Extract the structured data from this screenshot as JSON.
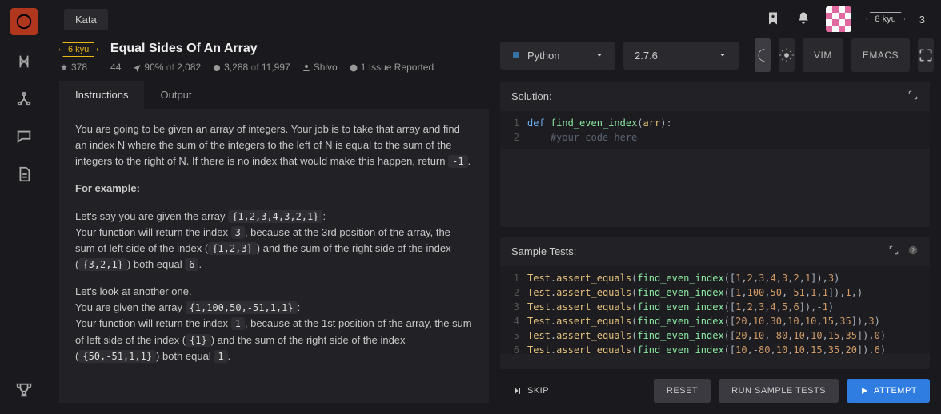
{
  "nav_tab": "Kata",
  "user": {
    "rank_label": "8 kyu",
    "points": "3"
  },
  "kata": {
    "rank": "6 kyu",
    "title": "Equal Sides Of An Array",
    "stars": "378",
    "collections": "44",
    "satisfaction_pct": "90%",
    "satisfaction_of": "of",
    "satisfaction_total": "2,082",
    "completed": "3,288",
    "completed_of": "of",
    "completed_total": "11,997",
    "author": "Shivo",
    "issues": "1 Issue Reported"
  },
  "tabs": {
    "instructions": "Instructions",
    "output": "Output"
  },
  "desc": {
    "p1a": "You are going to be given an array of integers. Your job is to take that array and find an index N where the sum of the integers to the left of N is equal to the sum of the integers to the right of N. If there is no index that would make this happen, return ",
    "p1_code": "-1",
    "p1b": ".",
    "h1": "For example:",
    "p2a": "Let's say you are given the array ",
    "p2_code1": "{1,2,3,4,3,2,1}",
    "p2b": ":",
    "p2c": "Your function will return the index ",
    "p2_code2": "3",
    "p2d": ", because at the 3rd position of the array, the sum of left side of the index (",
    "p2_code3": "{1,2,3}",
    "p2e": ") and the sum of the right side of the index (",
    "p2_code4": "{3,2,1}",
    "p2f": ") both equal ",
    "p2_code5": "6",
    "p2g": ".",
    "p3a": "Let's look at another one.",
    "p3b": "You are given the array ",
    "p3_code1": "{1,100,50,-51,1,1}",
    "p3c": ":",
    "p3d": "Your function will return the index ",
    "p3_code2": "1",
    "p3e": ", because at the 1st position of the array, the sum of left side of the index (",
    "p3_code3": "{1}",
    "p3f": ") and the sum of the right side of the index (",
    "p3_code4": "{50,-51,1,1}",
    "p3g": ") both equal ",
    "p3_code5": "1",
    "p3h": "."
  },
  "editor": {
    "language": "Python",
    "version": "2.7.6",
    "mode_vim": "VIM",
    "mode_emacs": "EMACS"
  },
  "solution": {
    "title": "Solution:",
    "lines": [
      {
        "n": "1",
        "html": "<span class='tk-kw'>def</span> <span class='tk-fn'>find_even_index</span><span class='tk-plain'>(</span><span class='tk-id'>arr</span><span class='tk-plain'>):</span>"
      },
      {
        "n": "2",
        "html": "    <span class='tk-cmt'>#your code here</span>"
      }
    ]
  },
  "tests": {
    "title": "Sample Tests:",
    "lines": [
      {
        "n": "1",
        "html": "<span class='tk-id'>Test</span><span class='tk-plain'>.</span><span class='tk-call'>assert_equals</span><span class='tk-plain'>(</span><span class='tk-fn'>find_even_index</span><span class='tk-plain'>([</span><span class='tk-num'>1</span><span class='tk-plain'>,</span><span class='tk-num'>2</span><span class='tk-plain'>,</span><span class='tk-num'>3</span><span class='tk-plain'>,</span><span class='tk-num'>4</span><span class='tk-plain'>,</span><span class='tk-num'>3</span><span class='tk-plain'>,</span><span class='tk-num'>2</span><span class='tk-plain'>,</span><span class='tk-num'>1</span><span class='tk-plain'>]),</span><span class='tk-num'>3</span><span class='tk-plain'>)</span>"
      },
      {
        "n": "2",
        "html": "<span class='tk-id'>Test</span><span class='tk-plain'>.</span><span class='tk-call'>assert_equals</span><span class='tk-plain'>(</span><span class='tk-fn'>find_even_index</span><span class='tk-plain'>([</span><span class='tk-num'>1</span><span class='tk-plain'>,</span><span class='tk-num'>100</span><span class='tk-plain'>,</span><span class='tk-num'>50</span><span class='tk-plain'>,-</span><span class='tk-num'>51</span><span class='tk-plain'>,</span><span class='tk-num'>1</span><span class='tk-plain'>,</span><span class='tk-num'>1</span><span class='tk-plain'>]),</span><span class='tk-num'>1</span><span class='tk-plain'>,)</span>"
      },
      {
        "n": "3",
        "html": "<span class='tk-id'>Test</span><span class='tk-plain'>.</span><span class='tk-call'>assert_equals</span><span class='tk-plain'>(</span><span class='tk-fn'>find_even_index</span><span class='tk-plain'>([</span><span class='tk-num'>1</span><span class='tk-plain'>,</span><span class='tk-num'>2</span><span class='tk-plain'>,</span><span class='tk-num'>3</span><span class='tk-plain'>,</span><span class='tk-num'>4</span><span class='tk-plain'>,</span><span class='tk-num'>5</span><span class='tk-plain'>,</span><span class='tk-num'>6</span><span class='tk-plain'>]),-</span><span class='tk-num'>1</span><span class='tk-plain'>)</span>"
      },
      {
        "n": "4",
        "html": "<span class='tk-id'>Test</span><span class='tk-plain'>.</span><span class='tk-call'>assert_equals</span><span class='tk-plain'>(</span><span class='tk-fn'>find_even_index</span><span class='tk-plain'>([</span><span class='tk-num'>20</span><span class='tk-plain'>,</span><span class='tk-num'>10</span><span class='tk-plain'>,</span><span class='tk-num'>30</span><span class='tk-plain'>,</span><span class='tk-num'>10</span><span class='tk-plain'>,</span><span class='tk-num'>10</span><span class='tk-plain'>,</span><span class='tk-num'>15</span><span class='tk-plain'>,</span><span class='tk-num'>35</span><span class='tk-plain'>]),</span><span class='tk-num'>3</span><span class='tk-plain'>)</span>"
      },
      {
        "n": "5",
        "html": "<span class='tk-id'>Test</span><span class='tk-plain'>.</span><span class='tk-call'>assert_equals</span><span class='tk-plain'>(</span><span class='tk-fn'>find_even_index</span><span class='tk-plain'>([</span><span class='tk-num'>20</span><span class='tk-plain'>,</span><span class='tk-num'>10</span><span class='tk-plain'>,-</span><span class='tk-num'>80</span><span class='tk-plain'>,</span><span class='tk-num'>10</span><span class='tk-plain'>,</span><span class='tk-num'>10</span><span class='tk-plain'>,</span><span class='tk-num'>15</span><span class='tk-plain'>,</span><span class='tk-num'>35</span><span class='tk-plain'>]),</span><span class='tk-num'>0</span><span class='tk-plain'>)</span>"
      },
      {
        "n": "6",
        "html": "<span class='tk-id'>Test</span><span class='tk-plain'>.</span><span class='tk-call'>assert_equals</span><span class='tk-plain'>(</span><span class='tk-fn'>find_even_index</span><span class='tk-plain'>([</span><span class='tk-num'>10</span><span class='tk-plain'>,-</span><span class='tk-num'>80</span><span class='tk-plain'>,</span><span class='tk-num'>10</span><span class='tk-plain'>,</span><span class='tk-num'>10</span><span class='tk-plain'>,</span><span class='tk-num'>15</span><span class='tk-plain'>,</span><span class='tk-num'>35</span><span class='tk-plain'>,</span><span class='tk-num'>20</span><span class='tk-plain'>]),</span><span class='tk-num'>6</span><span class='tk-plain'>)</span>"
      }
    ]
  },
  "buttons": {
    "skip": "SKIP",
    "reset": "RESET",
    "run": "RUN SAMPLE TESTS",
    "attempt": "ATTEMPT"
  }
}
